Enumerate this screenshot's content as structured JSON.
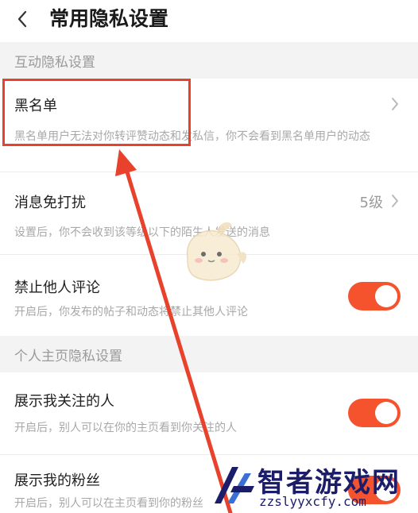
{
  "header": {
    "title": "常用隐私设置"
  },
  "sections": [
    {
      "header": "互动隐私设置"
    },
    {
      "header": "个人主页隐私设置"
    }
  ],
  "rows": {
    "blacklist": {
      "title": "黑名单",
      "desc": "黑名单用户无法对你转评赞动态和发私信，你不会看到黑名单用户的动态"
    },
    "dnd": {
      "title": "消息免打扰",
      "value": "5级",
      "desc": "设置后，你不会收到该等级以下的陌生人发送的消息"
    },
    "no_comment": {
      "title": "禁止他人评论",
      "desc": "开启后，你发布的帖子和动态将禁止其他人评论",
      "enabled": true
    },
    "show_following": {
      "title": "展示我关注的人",
      "desc": "开启后，别人可以在你的主页看到你关注的人",
      "enabled": true
    },
    "show_fans": {
      "title": "展示我的粉丝",
      "desc": "开启后，别人可以在主页看到你的粉丝"
    }
  },
  "watermark": {
    "name": "智者游戏网",
    "url": "zzslyyxcfy.com",
    "logo_color": "#1c1d6a"
  },
  "colors": {
    "toggle_on": "#f4532e",
    "annotation": "#e8412c",
    "section_bg": "#f3f3f3"
  }
}
